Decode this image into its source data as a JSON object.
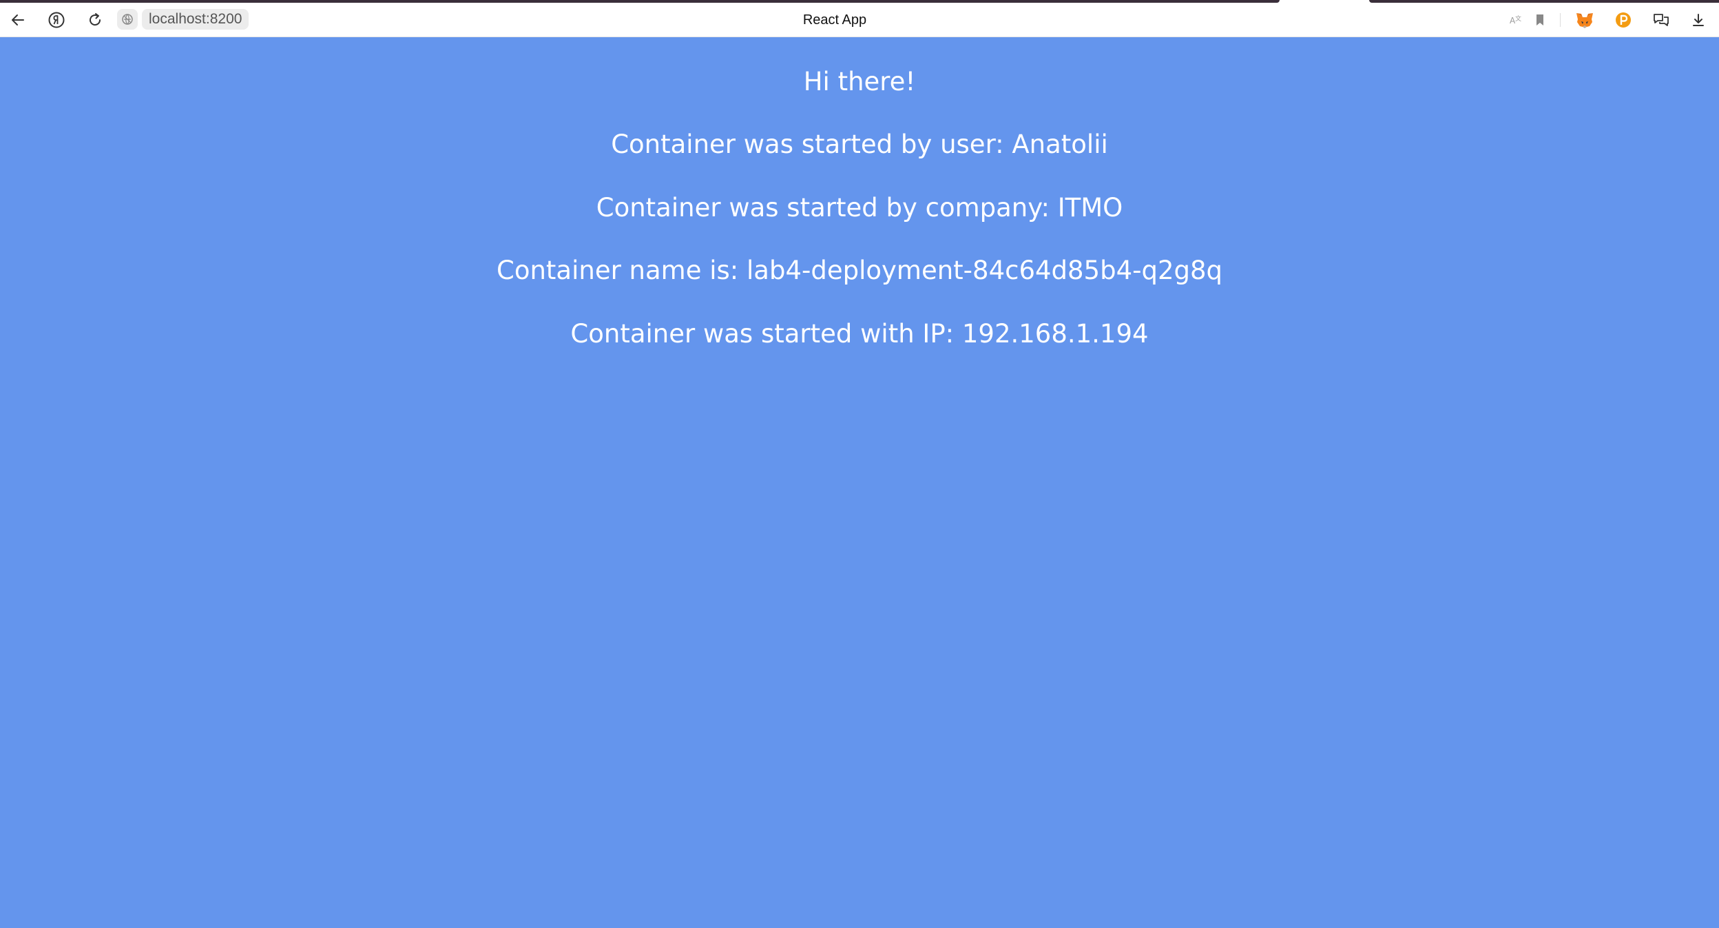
{
  "browser": {
    "url": "localhost:8200",
    "tab_title": "React App",
    "icons": {
      "back": "back-arrow-icon",
      "yandex": "yandex-logo-icon",
      "reload": "reload-icon",
      "site": "site-info-icon",
      "translate": "translate-icon",
      "bookmark": "bookmark-icon",
      "metamask": "metamask-fox-icon",
      "extension": "orange-coin-extension-icon",
      "chat": "chat-bubbles-icon",
      "download": "download-icon"
    }
  },
  "page": {
    "background_color": "#6495ed",
    "text_color": "#ffffff",
    "lines": [
      "Hi there!",
      "Container was started by user: Anatolii",
      "Container was started by company: ITMO",
      "Container name is: lab4-deployment-84c64d85b4-q2g8q",
      "Container was started with IP: 192.168.1.194"
    ]
  }
}
